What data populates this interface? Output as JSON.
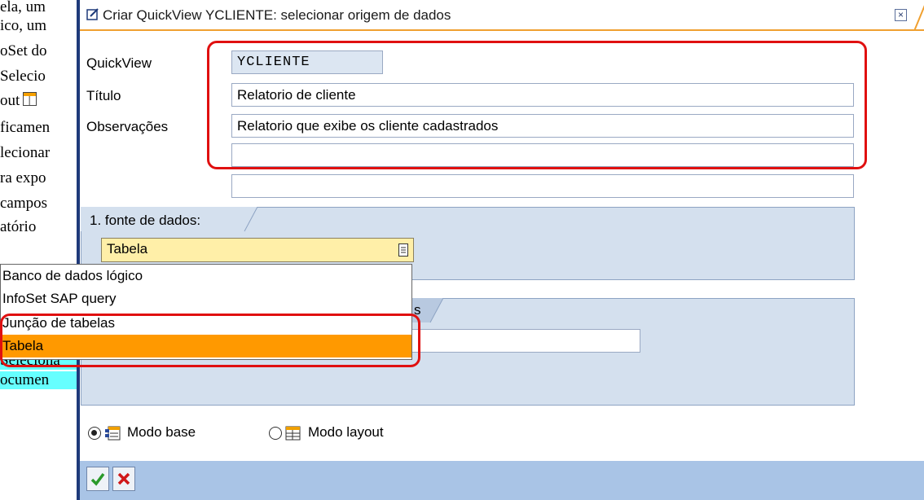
{
  "background_doc": {
    "lines": [
      "ela, um",
      "ico, um",
      "oSet do",
      "Selecio",
      "out",
      "ficamen",
      "lecionar",
      "ra expo",
      "campos",
      "atório",
      "Seleciona",
      "ocumen"
    ]
  },
  "dialog": {
    "title": "Criar QuickView YCLIENTE: selecionar origem de dados",
    "close_label": "×"
  },
  "form": {
    "quickview_label": "QuickView",
    "quickview_value": "YCLIENTE",
    "titulo_label": "Título",
    "titulo_value": "Relatorio de cliente",
    "observacoes_label": "Observações",
    "observacoes_line1": "Relatorio que exibe os cliente cadastrados",
    "observacoes_line2": "",
    "observacoes_line3": ""
  },
  "datasource": {
    "tab_label": "1. fonte de dados:",
    "selected_value": "Tabela",
    "options": [
      "Banco de dados lógico",
      "InfoSet SAP query",
      "Junção de tabelas",
      "Tabela"
    ],
    "selected_index": 3,
    "second_tab_label_fragment": "s",
    "second_input_value": ""
  },
  "modes": {
    "base_label": "Modo base",
    "layout_label": "Modo layout",
    "selected": "base"
  },
  "colors": {
    "highlight": "#ff9900",
    "annotation_red": "#e01010",
    "panel_blue": "#d4e0ee"
  }
}
